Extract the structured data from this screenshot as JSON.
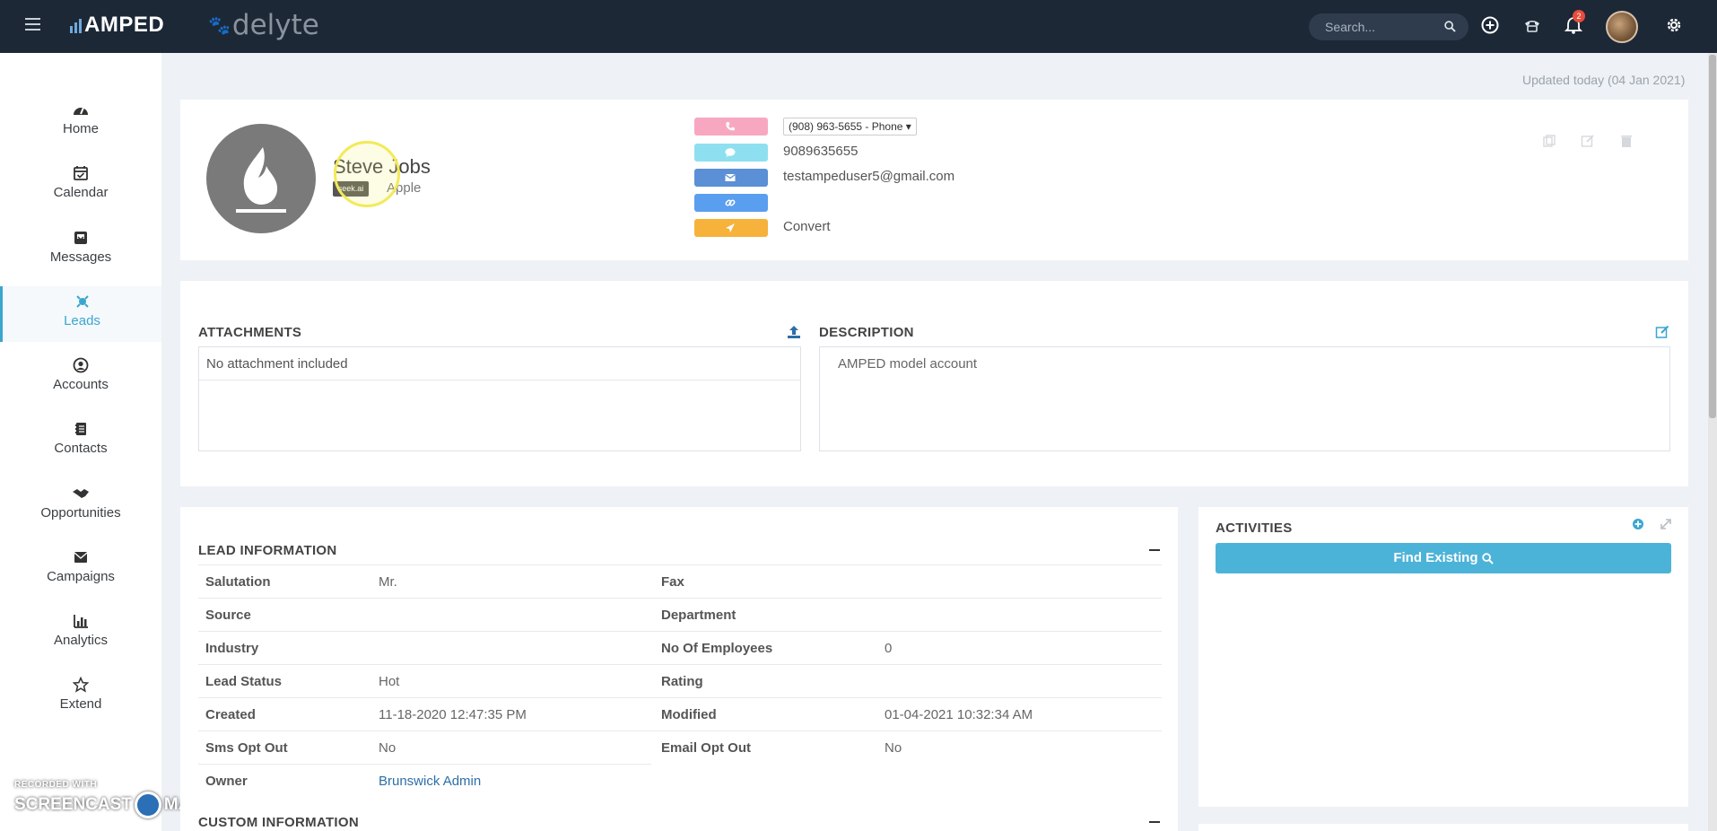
{
  "header": {
    "app_logo": "AMPED",
    "brand_logo": "delyte",
    "search_placeholder": "Search...",
    "notifications_count": "2"
  },
  "sidebar": {
    "items": [
      {
        "label": "Home",
        "icon": "dashboard-icon"
      },
      {
        "label": "Calendar",
        "icon": "calendar-icon"
      },
      {
        "label": "Messages",
        "icon": "inbox-icon"
      },
      {
        "label": "Leads",
        "icon": "leads-icon",
        "active": true
      },
      {
        "label": "Accounts",
        "icon": "user-circle-icon"
      },
      {
        "label": "Contacts",
        "icon": "address-book-icon"
      },
      {
        "label": "Opportunities",
        "icon": "handshake-icon"
      },
      {
        "label": "Campaigns",
        "icon": "envelope-icon"
      },
      {
        "label": "Analytics",
        "icon": "bar-chart-icon"
      },
      {
        "label": "Extend",
        "icon": "star-icon"
      }
    ]
  },
  "watermark": {
    "line1": "RECORDED WITH",
    "line2a": "SCREENCAST",
    "line2b": "MATIC"
  },
  "updated_text": "Updated today (04 Jan 2021)",
  "lead": {
    "name": "Steve Jobs",
    "tag": "seek.ai",
    "company": "Apple",
    "phone_select": "(908) 963-5655 - Phone",
    "sms": "9089635655",
    "email": "testampeduser5@gmail.com",
    "link": "",
    "convert": "Convert"
  },
  "attachments": {
    "title": "ATTACHMENTS",
    "empty_text": "No attachment included"
  },
  "description": {
    "title": "DESCRIPTION",
    "text": "AMPED model account"
  },
  "lead_information": {
    "title": "LEAD INFORMATION",
    "left": [
      {
        "label": "Salutation",
        "value": "Mr."
      },
      {
        "label": "Source",
        "value": ""
      },
      {
        "label": "Industry",
        "value": ""
      },
      {
        "label": "Lead Status",
        "value": "Hot"
      },
      {
        "label": "Created",
        "value": "11-18-2020 12:47:35 PM"
      },
      {
        "label": "Sms Opt Out",
        "value": "No"
      },
      {
        "label": "Owner",
        "value": "Brunswick Admin"
      }
    ],
    "right": [
      {
        "label": "Fax",
        "value": ""
      },
      {
        "label": "Department",
        "value": ""
      },
      {
        "label": "No Of Employees",
        "value": "0"
      },
      {
        "label": "Rating",
        "value": ""
      },
      {
        "label": "Modified",
        "value": "01-04-2021 10:32:34 AM"
      },
      {
        "label": "Email Opt Out",
        "value": "No"
      }
    ]
  },
  "custom_information": {
    "title": "CUSTOM INFORMATION"
  },
  "activities": {
    "title": "ACTIVITIES",
    "find_button": "Find Existing"
  },
  "colors": {
    "topbar": "#1c2836",
    "accent": "#3aa6d0",
    "phone_button": "#f7a8c0",
    "sms_button": "#8ee0f0",
    "email_button": "#5b8fd6",
    "link_button": "#5a9ef0",
    "convert_button": "#f7b23b",
    "find_button": "#4cb3d8",
    "owner_link": "#2d6ea8"
  }
}
